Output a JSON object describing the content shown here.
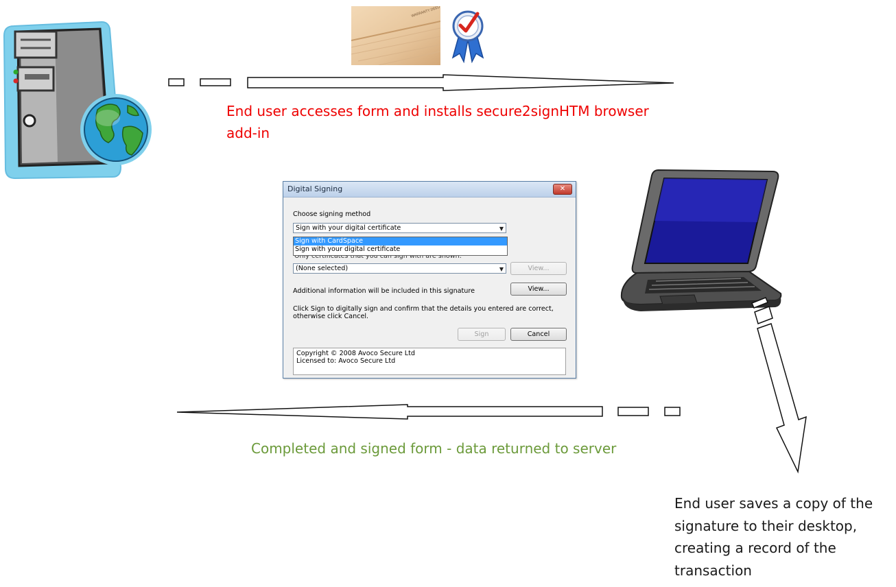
{
  "captions": {
    "top": "End user accesses form and installs secure2signHTM browser add-in",
    "middle": "Completed and signed form - data returned to server",
    "right": "End user saves a copy of the signature to their desktop, creating a record of the transaction"
  },
  "deed_image_text": "WARRANTY DEED",
  "dialog": {
    "title": "Digital Signing",
    "close_label": "✕",
    "choose_label": "Choose signing method",
    "method_value": "Sign with your digital certificate",
    "dropdown_options": [
      "Sign with CardSpace",
      "Sign with your digital certificate"
    ],
    "cert_note": "Only certificates that you can sign with are shown.",
    "cert_value": "(None selected)",
    "view_label": "View...",
    "additional_info": "Additional information will be included in this signature",
    "instructions": "Click Sign to digitally sign and confirm that the details you entered are correct, otherwise click Cancel.",
    "sign_label": "Sign",
    "cancel_label": "Cancel",
    "copyright": "Copyright © 2008 Avoco Secure Ltd",
    "licensed": "Licensed to: Avoco Secure Ltd"
  },
  "colors": {
    "top_caption": "#ee0000",
    "middle_caption": "#6b9a3a",
    "right_caption": "#1a1a1a"
  },
  "icons": [
    "server-tower-icon",
    "globe-icon",
    "warranty-deed-image",
    "certificate-ribbon-icon",
    "laptop-icon"
  ]
}
